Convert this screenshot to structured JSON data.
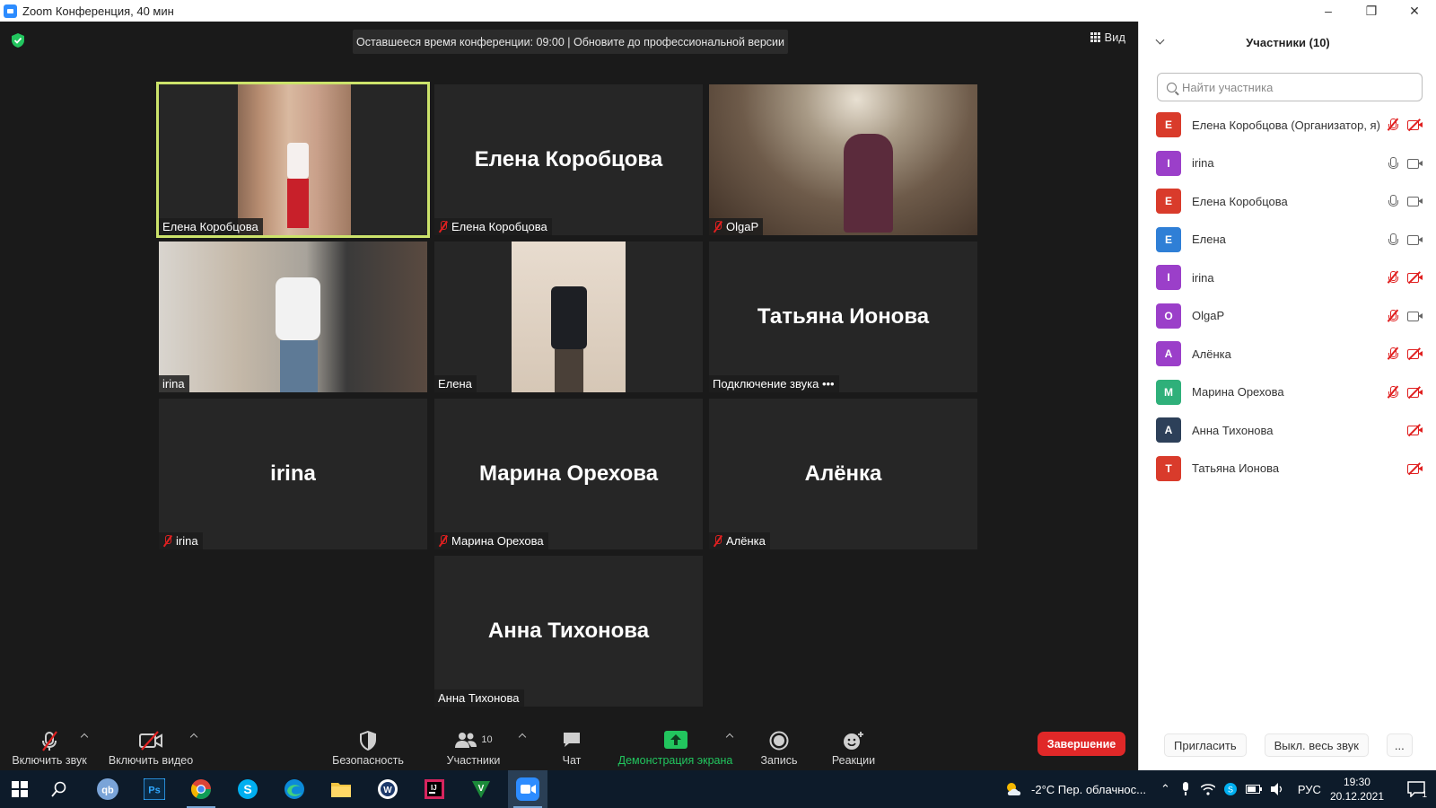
{
  "window": {
    "title": "Zoom Конференция, 40 мин",
    "controls": [
      "–",
      "❐",
      "✕"
    ]
  },
  "meeting": {
    "time_banner": "Оставшееся время конференции: 09:00 | Обновите до профессиональной версии",
    "view_label": "Вид"
  },
  "tiles": [
    {
      "big_name": "",
      "tag": "Елена Коробцова",
      "muted": false,
      "video": "v1",
      "active": true
    },
    {
      "big_name": "Елена Коробцова",
      "tag": "Елена Коробцова",
      "muted": true,
      "video": "",
      "active": false
    },
    {
      "big_name": "",
      "tag": "OlgaP",
      "muted": true,
      "video": "v3",
      "active": false
    },
    {
      "big_name": "",
      "tag": "irina",
      "muted": false,
      "video": "v4",
      "active": false
    },
    {
      "big_name": "",
      "tag": "Елена",
      "muted": false,
      "video": "v5",
      "active": false
    },
    {
      "big_name": "Татьяна Ионова",
      "tag": "Подключение звука •••",
      "muted": false,
      "video": "",
      "active": false
    },
    {
      "big_name": "irina",
      "tag": "irina",
      "muted": true,
      "video": "",
      "active": false
    },
    {
      "big_name": "Марина Орехова",
      "tag": "Марина Орехова",
      "muted": true,
      "video": "",
      "active": false
    },
    {
      "big_name": "Алёнка",
      "tag": "Алёнка",
      "muted": true,
      "video": "",
      "active": false
    },
    {
      "big_name": "Анна Тихонова",
      "tag": "Анна Тихонова",
      "muted": false,
      "video": "",
      "active": false
    }
  ],
  "sidebar": {
    "title": "Участники (10)",
    "search_placeholder": "Найти участника",
    "participants": [
      {
        "initial": "E",
        "color": "#d93b2b",
        "name": "Елена Коробцова (Организатор, я)",
        "mic": "off",
        "cam": "off"
      },
      {
        "initial": "I",
        "color": "#9b3fc9",
        "name": "irina",
        "mic": "on",
        "cam": "on"
      },
      {
        "initial": "E",
        "color": "#d93b2b",
        "name": "Елена Коробцова",
        "mic": "on",
        "cam": "on"
      },
      {
        "initial": "E",
        "color": "#2f7fd6",
        "name": "Елена",
        "mic": "on",
        "cam": "on"
      },
      {
        "initial": "I",
        "color": "#9b3fc9",
        "name": "irina",
        "mic": "off",
        "cam": "off"
      },
      {
        "initial": "O",
        "color": "#9b3fc9",
        "name": "OlgaP",
        "mic": "off",
        "cam": "on"
      },
      {
        "initial": "A",
        "color": "#9b3fc9",
        "name": "Алёнка",
        "mic": "off",
        "cam": "off"
      },
      {
        "initial": "M",
        "color": "#2fb07a",
        "name": "Марина Орехова",
        "mic": "off",
        "cam": "off"
      },
      {
        "initial": "A",
        "color": "#2d4059",
        "name": "Анна Тихонова",
        "mic": "none",
        "cam": "off"
      },
      {
        "initial": "T",
        "color": "#d93b2b",
        "name": "Татьяна Ионова",
        "mic": "none",
        "cam": "off"
      }
    ],
    "invite_label": "Пригласить",
    "mute_all_label": "Выкл. весь звук",
    "more_label": "..."
  },
  "toolbar": {
    "unmute_label": "Включить звук",
    "start_video_label": "Включить видео",
    "security_label": "Безопасность",
    "participants_label": "Участники",
    "participants_count": "10",
    "chat_label": "Чат",
    "share_label": "Демонстрация экрана",
    "record_label": "Запись",
    "reactions_label": "Реакции",
    "end_label": "Завершение"
  },
  "taskbar": {
    "weather": "-2°C  Пер. облачнос...",
    "lang": "РУС",
    "time": "19:30",
    "date": "20.12.2021",
    "notif_count": "1"
  },
  "colors": {
    "accent_green": "#22c55e",
    "active_border": "#cce36b",
    "end_red": "#e02828",
    "muted_red": "#e02020"
  }
}
